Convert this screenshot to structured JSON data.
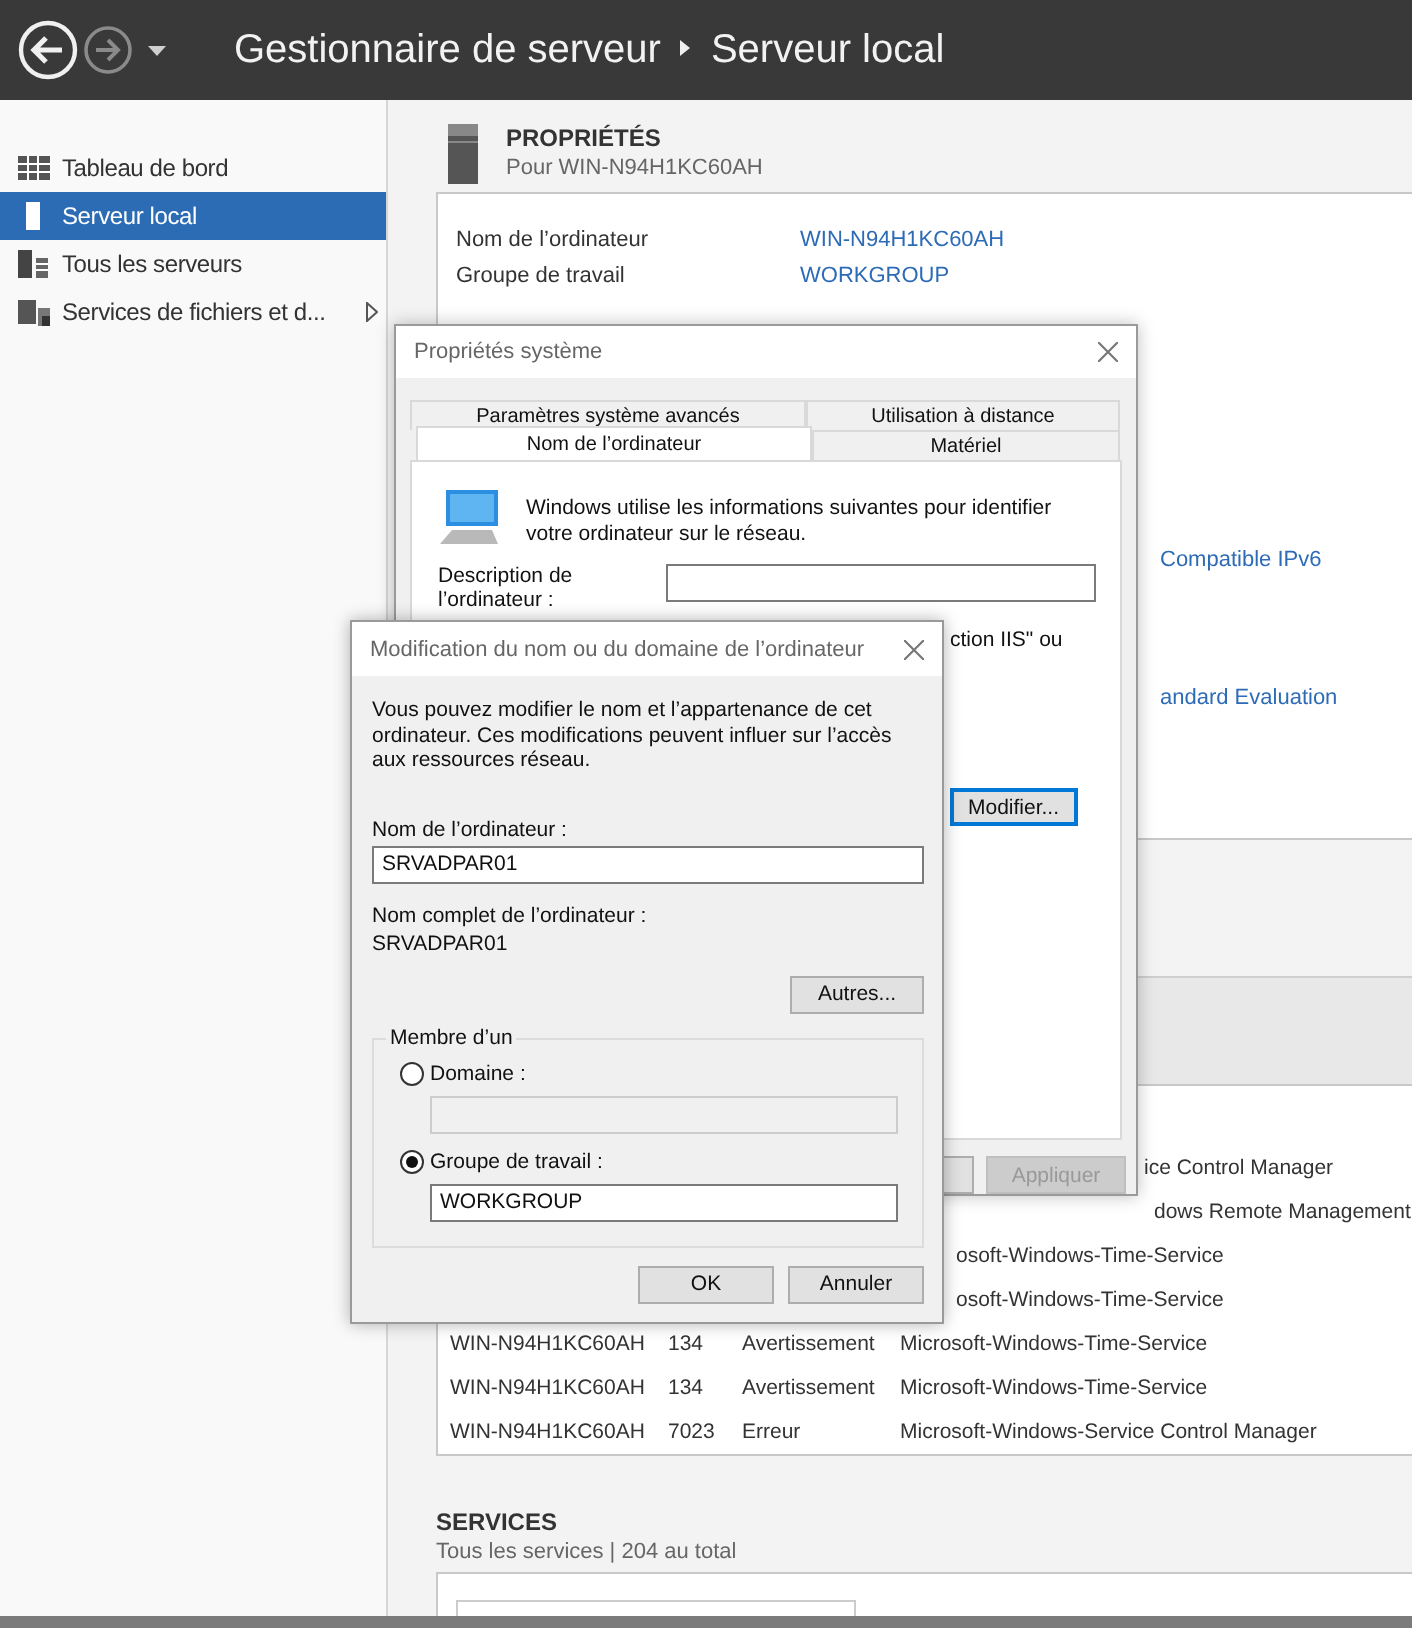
{
  "header": {
    "title": "Gestionnaire de serveur",
    "page": "Serveur local"
  },
  "sidebar": {
    "items": [
      {
        "label": "Tableau de bord",
        "kind": "dashboard",
        "selected": false,
        "expandable": false
      },
      {
        "label": "Serveur local",
        "kind": "server",
        "selected": true,
        "expandable": false
      },
      {
        "label": "Tous les serveurs",
        "kind": "servers",
        "selected": false,
        "expandable": false
      },
      {
        "label": "Services de fichiers et d...",
        "kind": "files",
        "selected": false,
        "expandable": true
      }
    ]
  },
  "properties": {
    "title": "PROPRIÉTÉS",
    "subtitle": "Pour WIN-N94H1KC60AH",
    "fields": [
      {
        "label": "Nom de l’ordinateur",
        "value": "WIN-N94H1KC60AH"
      },
      {
        "label": "Groupe de travail",
        "value": "WORKGROUP"
      }
    ],
    "fragments": [
      "Compatible IPv6",
      "andard Evaluation"
    ]
  },
  "events": {
    "rows": [
      {
        "source": "ice Control Manager"
      },
      {
        "source": "dows Remote Management"
      },
      {
        "source": "osoft-Windows-Time-Service"
      },
      {
        "source": "osoft-Windows-Time-Service"
      },
      {
        "server": "WIN-N94H1KC60AH",
        "id": "134",
        "severity": "Avertissement",
        "source": "Microsoft-Windows-Time-Service"
      },
      {
        "server": "WIN-N94H1KC60AH",
        "id": "134",
        "severity": "Avertissement",
        "source": "Microsoft-Windows-Time-Service"
      },
      {
        "server": "WIN-N94H1KC60AH",
        "id": "7023",
        "severity": "Erreur",
        "source": "Microsoft-Windows-Service Control Manager"
      }
    ]
  },
  "services": {
    "title": "SERVICES",
    "subtitle": "Tous les services | 204 au total"
  },
  "system_dialog": {
    "title": "Propriétés système",
    "tab_rows": [
      [
        {
          "label": "Paramètres système avancés",
          "selected": false
        },
        {
          "label": "Utilisation à distance",
          "selected": false
        }
      ],
      [
        {
          "label": "Nom de l’ordinateur",
          "selected": true
        },
        {
          "label": "Matériel",
          "selected": false
        }
      ]
    ],
    "intro": "Windows utilise les informations suivantes pour identifier votre ordinateur sur le réseau.",
    "description_label": "Description de l’ordinateur :",
    "note_fragment": "ction IIS\" ou",
    "modify_button": {
      "label": "Modifier...",
      "focused": true
    },
    "footer_buttons": [
      {
        "label": "Appliquer",
        "disabled": true
      }
    ]
  },
  "modify_dialog": {
    "title": "Modification du nom ou du domaine de l’ordinateur",
    "intro": "Vous pouvez modifier le nom et l’appartenance de cet ordinateur. Ces modifications peuvent influer sur l’accès aux ressources réseau.",
    "name_label": "Nom de l’ordinateur :",
    "name_value": "SRVADPAR01",
    "full_name_label": "Nom complet de l’ordinateur :",
    "full_name": "SRVADPAR01",
    "more_button": "Autres...",
    "member_group": {
      "title": "Membre d’un",
      "options": [
        {
          "label": "Domaine :",
          "selected": false,
          "field_disabled": true
        },
        {
          "label": "Groupe de travail :",
          "selected": true,
          "field_disabled": false,
          "value": "WORKGROUP"
        }
      ]
    },
    "buttons": [
      "OK",
      "Annuler"
    ]
  }
}
